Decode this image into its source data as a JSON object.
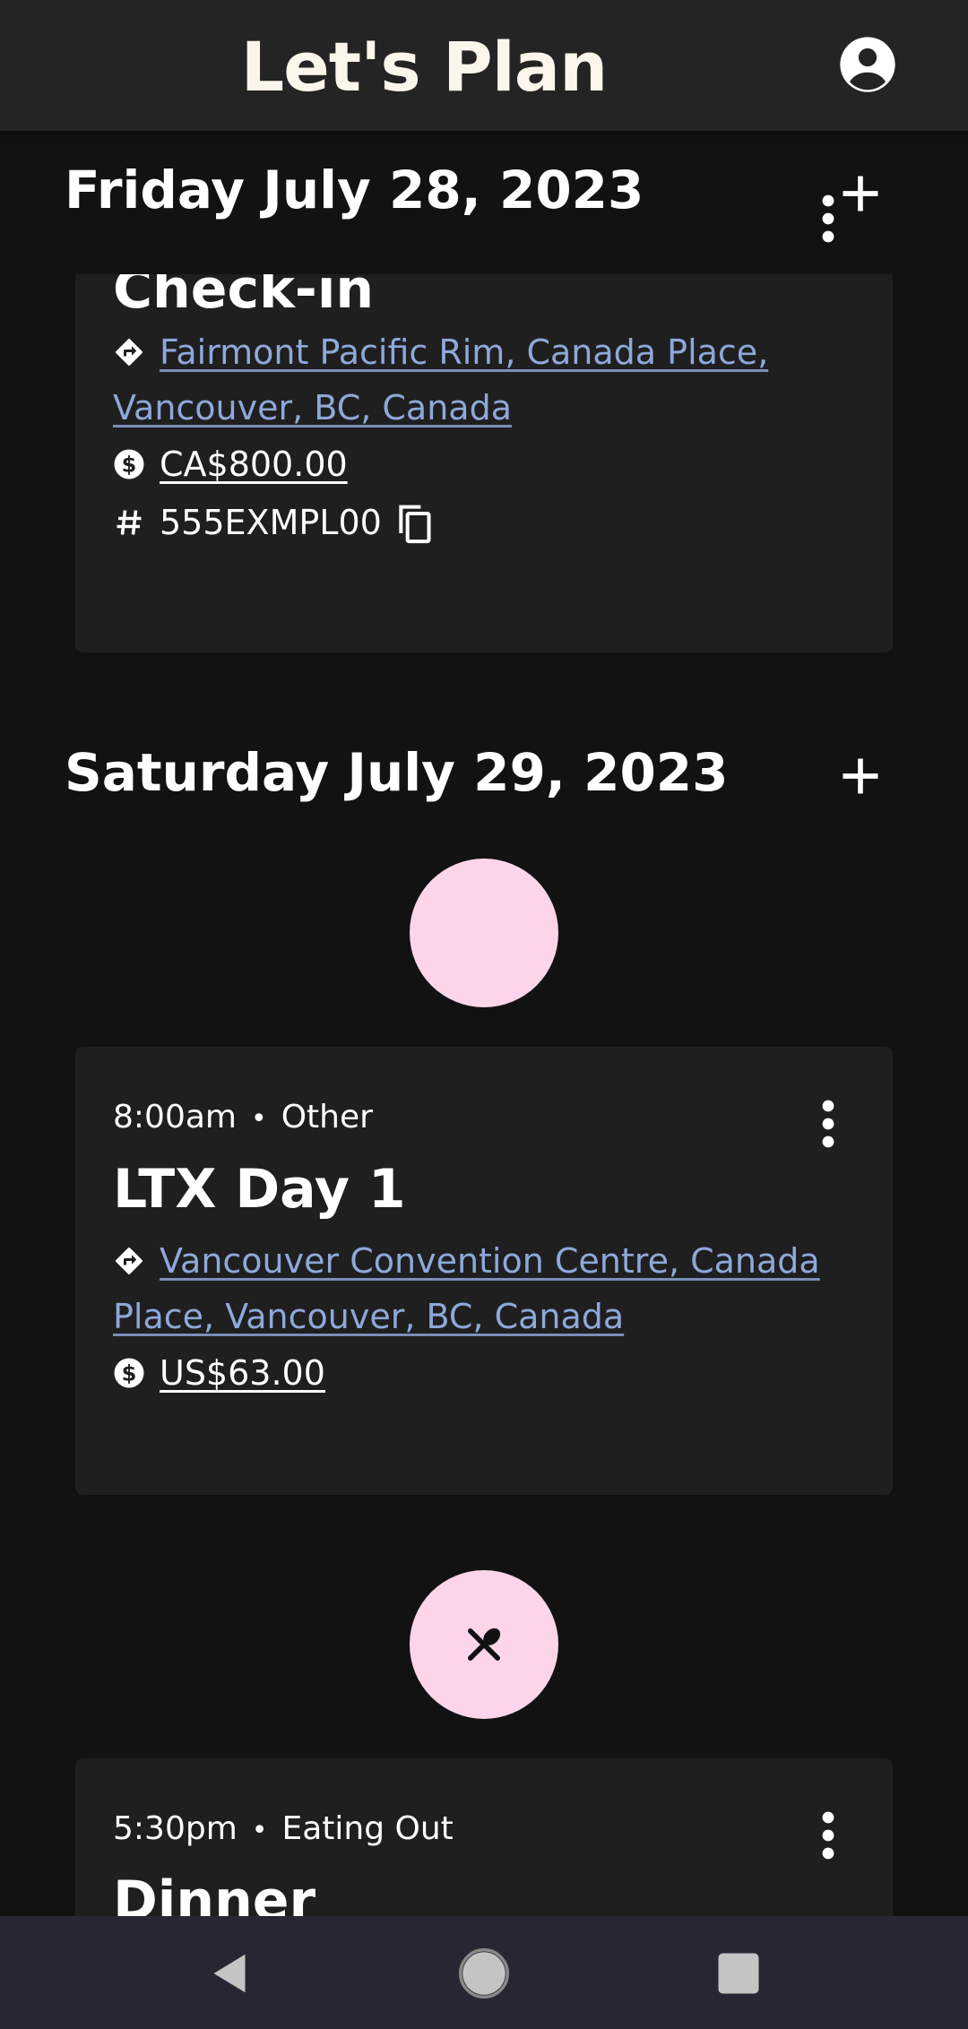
{
  "app": {
    "title": "Let's Plan"
  },
  "days": [
    {
      "date": "Friday July 28, 2023",
      "cards": [
        {
          "title": "Check-in",
          "location": "Fairmont Pacific Rim, Canada Place, Vancouver, BC, Canada",
          "cost": "CA$800.00",
          "confirmation": "555EXMPL00"
        }
      ]
    },
    {
      "date": "Saturday July 29, 2023",
      "cards": [
        {
          "time": "8:00am",
          "category": "Other",
          "title": "LTX Day 1",
          "location": "Vancouver Convention Centre, Canada Place, Vancouver, BC, Canada",
          "cost": "US$63.00"
        },
        {
          "time": "5:30pm",
          "category": "Eating Out",
          "title": "Dinner"
        }
      ]
    }
  ],
  "icons": {
    "account": "account-circle-icon",
    "add": "plus-icon",
    "more": "more-vertical-icon",
    "location": "directions-icon",
    "cost": "dollar-circle-icon",
    "confirmation": "hash-icon",
    "copy": "copy-icon",
    "restaurant": "fork-spoon-icon"
  },
  "colors": {
    "background": "#121212",
    "app_bar": "#242424",
    "card": "#1f1f1f",
    "link": "#8ea8da",
    "category_circle": "#fdd5eb",
    "nav_bar": "#272632"
  }
}
